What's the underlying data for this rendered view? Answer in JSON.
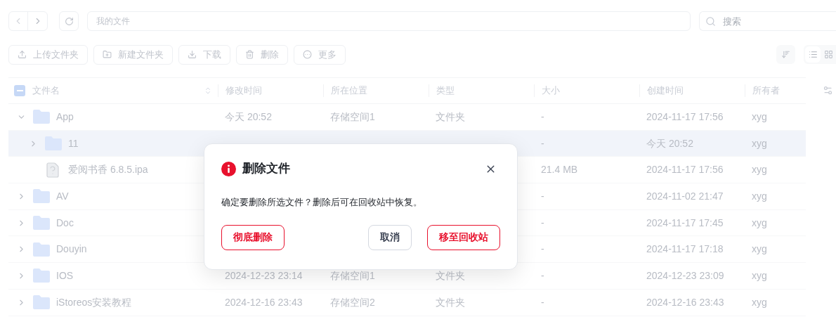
{
  "nav": {
    "path": "我的文件",
    "search_placeholder": "搜索"
  },
  "actions": [
    {
      "kind": "upload",
      "label": "上传文件夹"
    },
    {
      "kind": "new-folder",
      "label": "新建文件夹"
    },
    {
      "kind": "download",
      "label": "下载"
    },
    {
      "kind": "delete",
      "label": "删除"
    },
    {
      "kind": "more",
      "label": "更多"
    }
  ],
  "view_modes": [
    {
      "kind": "list",
      "selected": true
    },
    {
      "kind": "grid",
      "selected": false
    }
  ],
  "table": {
    "indeterminate": true,
    "columns": [
      "文件名",
      "修改时间",
      "所在位置",
      "类型",
      "大小",
      "创建时间",
      "所有者"
    ],
    "rows": [
      {
        "kind": "folder",
        "name": "App",
        "expanded": true,
        "selected": false,
        "modified": "今天 20:52",
        "location": "存储空间1",
        "type": "文件夹",
        "size": "-",
        "created": "2024-11-17 17:56",
        "owner": "xyg",
        "children": [
          {
            "kind": "folder",
            "name": "11",
            "expanded": false,
            "selected": true,
            "size": "-",
            "created": "今天 20:52",
            "owner": "xyg"
          },
          {
            "kind": "file",
            "name": "爱阅书香 6.8.5.ipa",
            "selected": false,
            "size": "21.4 MB",
            "created": "2024-11-17 17:56",
            "owner": "xyg"
          }
        ]
      },
      {
        "kind": "folder",
        "name": "AV",
        "expanded": false,
        "selected": false,
        "size": "-",
        "created": "2024-11-02 21:47",
        "owner": "xyg"
      },
      {
        "kind": "folder",
        "name": "Doc",
        "expanded": false,
        "selected": false,
        "size": "-",
        "created": "2024-11-17 17:45",
        "owner": "xyg"
      },
      {
        "kind": "folder",
        "name": "Douyin",
        "expanded": false,
        "selected": false,
        "size": "-",
        "created": "2024-11-17 17:18",
        "owner": "xyg"
      },
      {
        "kind": "folder",
        "name": "IOS",
        "expanded": false,
        "selected": false,
        "modified": "2024-12-23 23:14",
        "location": "存储空间1",
        "type": "文件夹",
        "size": "-",
        "created": "2024-12-23 23:09",
        "owner": "xyg"
      },
      {
        "kind": "folder",
        "name": "iStoreos安装教程",
        "expanded": false,
        "selected": false,
        "modified": "2024-12-16 23:43",
        "location": "存储空间2",
        "type": "文件夹",
        "size": "-",
        "created": "2024-12-16 23:43",
        "owner": "xyg"
      }
    ]
  },
  "dialog": {
    "title": "删除文件",
    "message": "确定要删除所选文件？删除后可在回收站中恢复。",
    "buttons": [
      {
        "kind": "danger",
        "label": "彻底删除"
      },
      {
        "kind": "cancel",
        "label": "取消"
      },
      {
        "kind": "danger",
        "label": "移至回收站"
      }
    ]
  }
}
